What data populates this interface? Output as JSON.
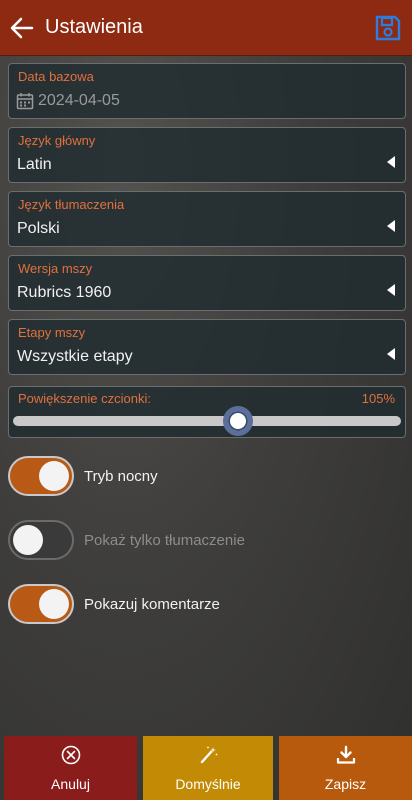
{
  "header": {
    "title": "Ustawienia"
  },
  "fields": [
    {
      "label": "Data bazowa",
      "value": "2024-04-05"
    },
    {
      "label": "Język główny",
      "value": "Latin"
    },
    {
      "label": "Język tłumaczenia",
      "value": "Polski"
    },
    {
      "label": "Wersja mszy",
      "value": "Rubrics 1960"
    },
    {
      "label": "Etapy mszy",
      "value": "Wszystkie etapy"
    }
  ],
  "font_scale": {
    "label": "Powiększenie czcionki:",
    "value_text": "105%",
    "level": 0.58
  },
  "toggles": [
    {
      "label": "Tryb nocny",
      "on": true
    },
    {
      "label": "Pokaż tylko tłumaczenie",
      "on": false
    },
    {
      "label": "Pokazuj komentarze",
      "on": true
    }
  ],
  "actions": {
    "cancel": "Anuluj",
    "defaults": "Domyślnie",
    "save": "Zapisz"
  },
  "colors": {
    "appbar": "#8e2a12",
    "label_accent": "#e0703f",
    "switch_on": "#b85a15",
    "cancel_bg": "#8a1c1c",
    "default_bg": "#c28a05",
    "save_bg": "#b85a0e",
    "save_icon": "#2b7de0"
  },
  "icons": {
    "back": "arrow-left-icon",
    "save_top": "floppy-disk-icon",
    "calendar": "calendar-icon",
    "dropdown": "caret-left-icon",
    "cancel": "close-circle-icon",
    "defaults": "magic-wand-icon",
    "save": "download-icon"
  }
}
